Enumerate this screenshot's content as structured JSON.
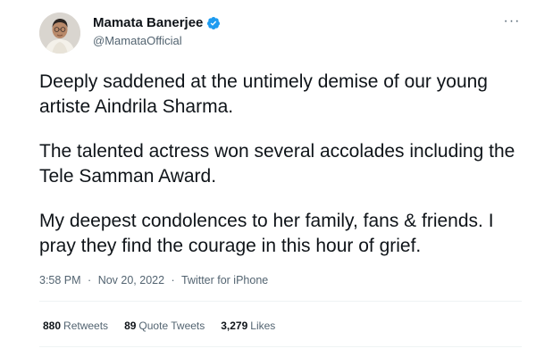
{
  "author": {
    "name": "Mamata Banerjee",
    "handle": "@MamataOfficial",
    "verified_color": "#1d9bf0"
  },
  "tweet": {
    "paragraphs": [
      "Deeply saddened at the untimely demise of our young artiste Aindrila Sharma.",
      "The talented actress won several accolades including the Tele Samman Award.",
      "My deepest condolences to her family, fans & friends. I pray they find the courage in this hour of grief."
    ]
  },
  "meta": {
    "time": "3:58 PM",
    "separator": "·",
    "date": "Nov 20, 2022",
    "source": "Twitter for iPhone"
  },
  "stats": {
    "retweets": {
      "count": "880",
      "label": "Retweets"
    },
    "quote_tweets": {
      "count": "89",
      "label": "Quote Tweets"
    },
    "likes": {
      "count": "3,279",
      "label": "Likes"
    }
  },
  "icons": {
    "more": "more-options-icon",
    "verified": "verified-badge-icon"
  },
  "more_glyph": "···"
}
